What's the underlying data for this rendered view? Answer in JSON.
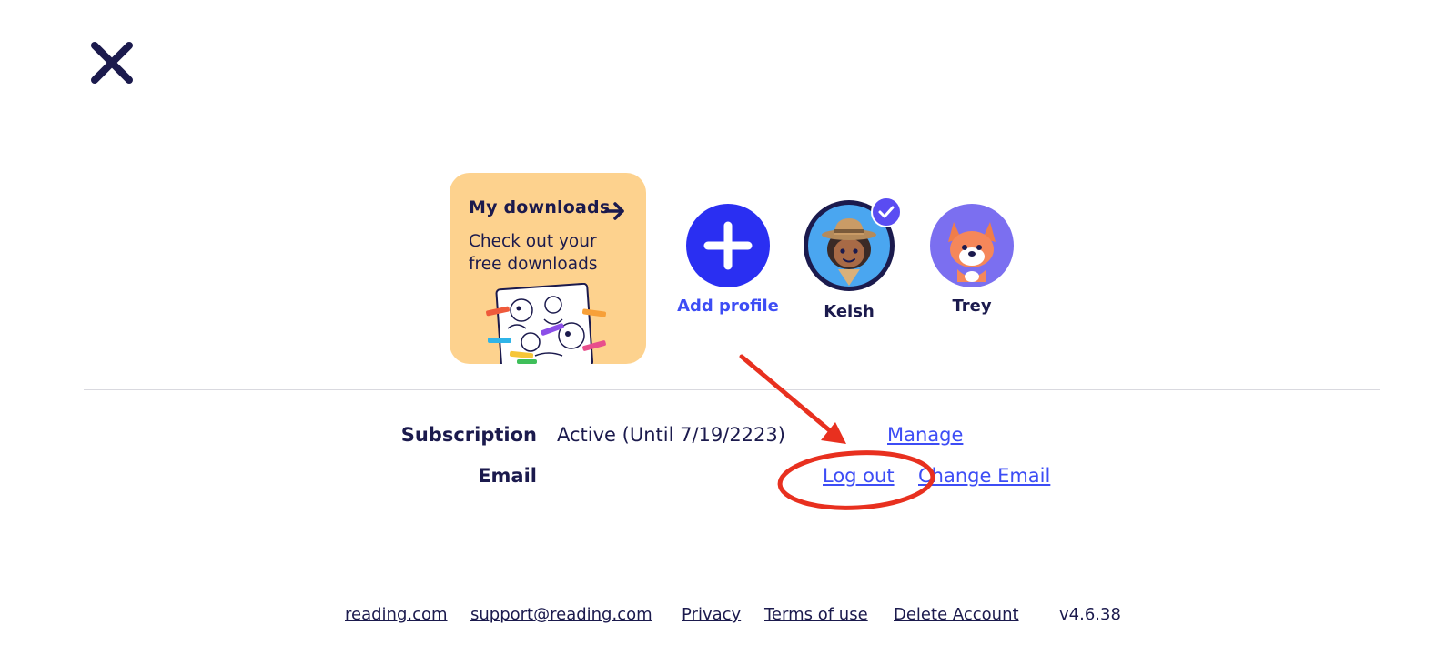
{
  "downloads_card": {
    "title": "My downloads",
    "subtitle": "Check out your free downloads"
  },
  "profiles": [
    {
      "name": "Add profile",
      "icon": "plus-icon"
    },
    {
      "name": "Keish",
      "icon": "ranger-girl-avatar",
      "selected": true
    },
    {
      "name": "Trey",
      "icon": "fox-avatar"
    }
  ],
  "account": {
    "subscription_label": "Subscription",
    "subscription_value": "Active (Until 7/19/2223)",
    "manage_label": "Manage",
    "email_label": "Email",
    "logout_label": "Log out",
    "change_email_label": "Change Email"
  },
  "footer": {
    "links": [
      "reading.com",
      "support@reading.com",
      "Privacy",
      "Terms of use",
      "Delete Account"
    ],
    "version": "v4.6.38"
  },
  "colors": {
    "navy": "#1b1a4d",
    "brand_blue": "#3d4df5",
    "card_yellow": "#fdd28e",
    "annotation_red": "#e8301f",
    "trey_bg": "#7b6ff0"
  }
}
